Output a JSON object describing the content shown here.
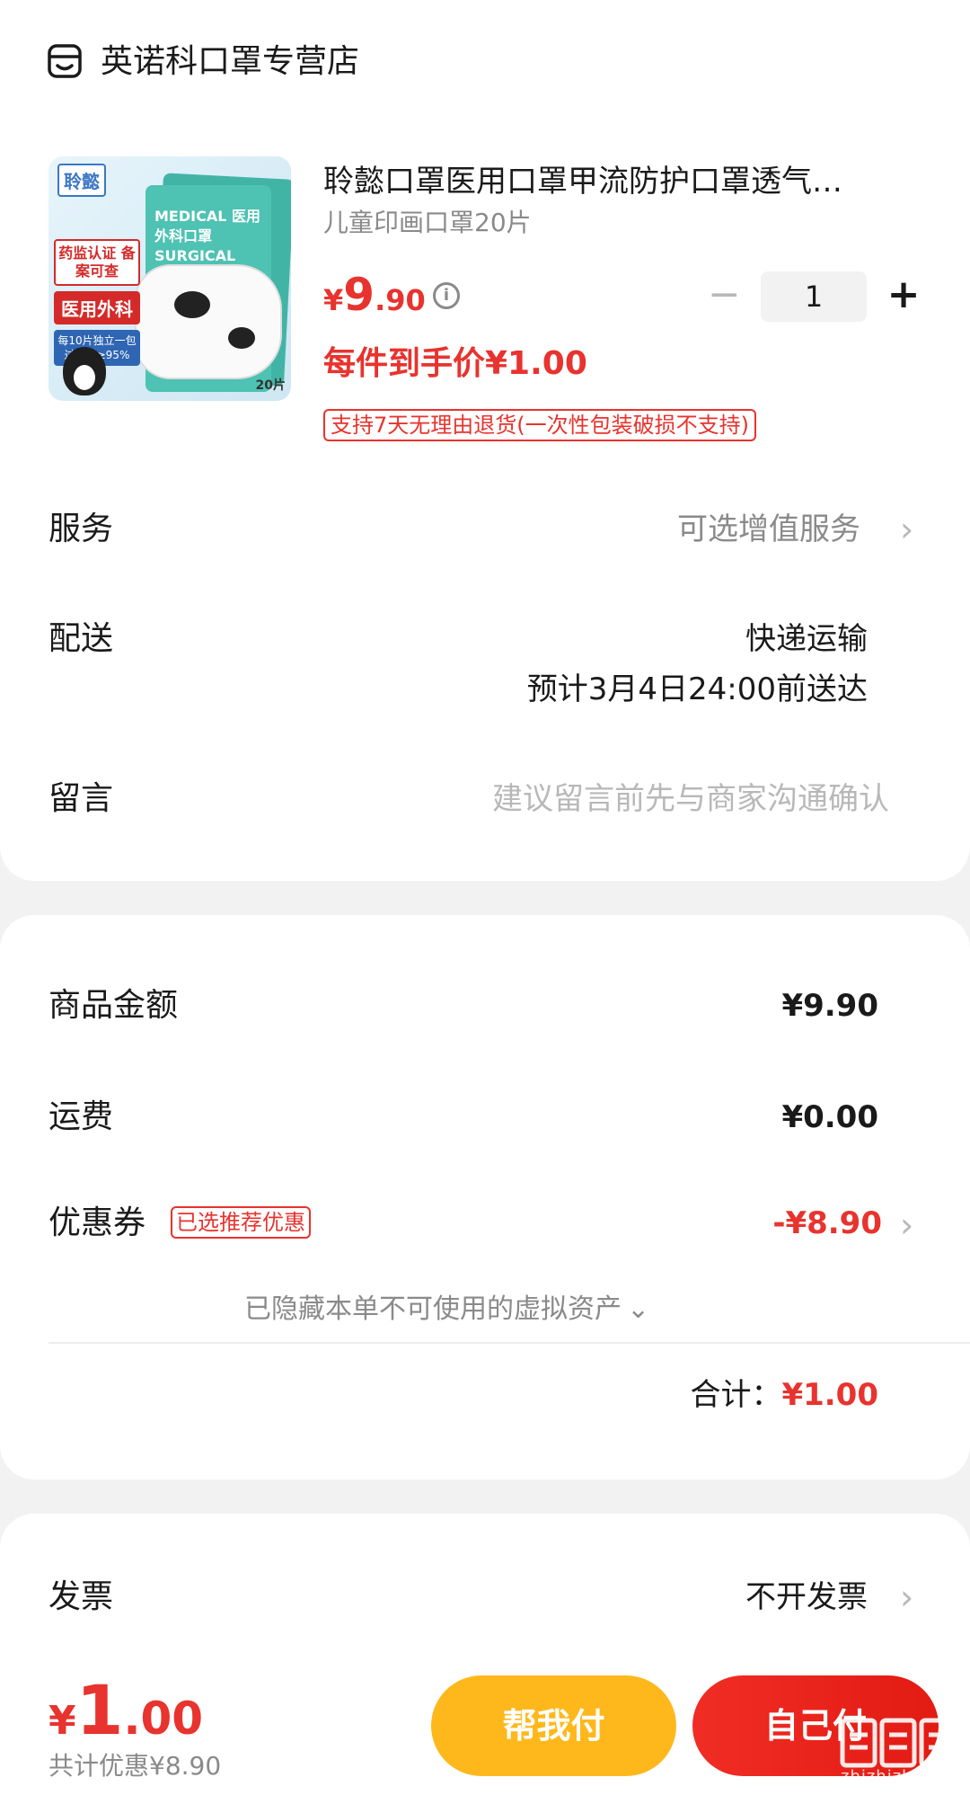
{
  "shop": {
    "icon": "shop-icon",
    "name": "英诺科口罩专营店"
  },
  "product": {
    "title": "聆懿口罩医用口罩甲流防护口罩透气…",
    "subtitle": "儿童印画口罩20片",
    "price_currency": "¥",
    "price_int": "9",
    "price_dec": ".90",
    "info_icon": "info-icon",
    "quantity": "1",
    "hand_price": "每件到手价¥1.00",
    "return_policy": "支持7天无理由退货(一次性包装破损不支持)",
    "image": {
      "brand": "聆懿",
      "tag1": "药监认证 备案可查",
      "tag2": "医用外科",
      "tag3": "每10片独立一包 过滤率≥95%",
      "pack_title": "MEDICAL 医用外科口罩 SURGICAL MASK",
      "count": "20片"
    }
  },
  "rows": {
    "service": {
      "label": "服务",
      "value": "可选增值服务"
    },
    "delivery": {
      "label": "配送",
      "value1": "快递运输",
      "value2": "预计3月4日24:00前送达"
    },
    "message": {
      "label": "留言",
      "placeholder": "建议留言前先与商家沟通确认"
    }
  },
  "summary": {
    "goods": {
      "label": "商品金额",
      "value": "¥9.90"
    },
    "shipping": {
      "label": "运费",
      "value": "¥0.00"
    },
    "coupon": {
      "label": "优惠券",
      "badge": "已选推荐优惠",
      "value": "-¥8.90"
    },
    "hidden_assets": "已隐藏本单不可使用的虚拟资产",
    "total_label": "合计：",
    "total_value": "¥1.00"
  },
  "invoice": {
    "label": "发票",
    "value": "不开发票"
  },
  "bottom": {
    "currency": "¥",
    "total_int": "1",
    "total_dec": ".00",
    "discount": "共计优惠¥8.90",
    "help_pay": "帮我付",
    "self_pay": "自己付"
  },
  "watermark": {
    "icon": "zhizhizhi-logo",
    "text": "zhizhizhi.com"
  },
  "colors": {
    "accent_red": "#e8332e",
    "help_yellow": "#ffb81c",
    "muted": "#8a8a8a"
  }
}
